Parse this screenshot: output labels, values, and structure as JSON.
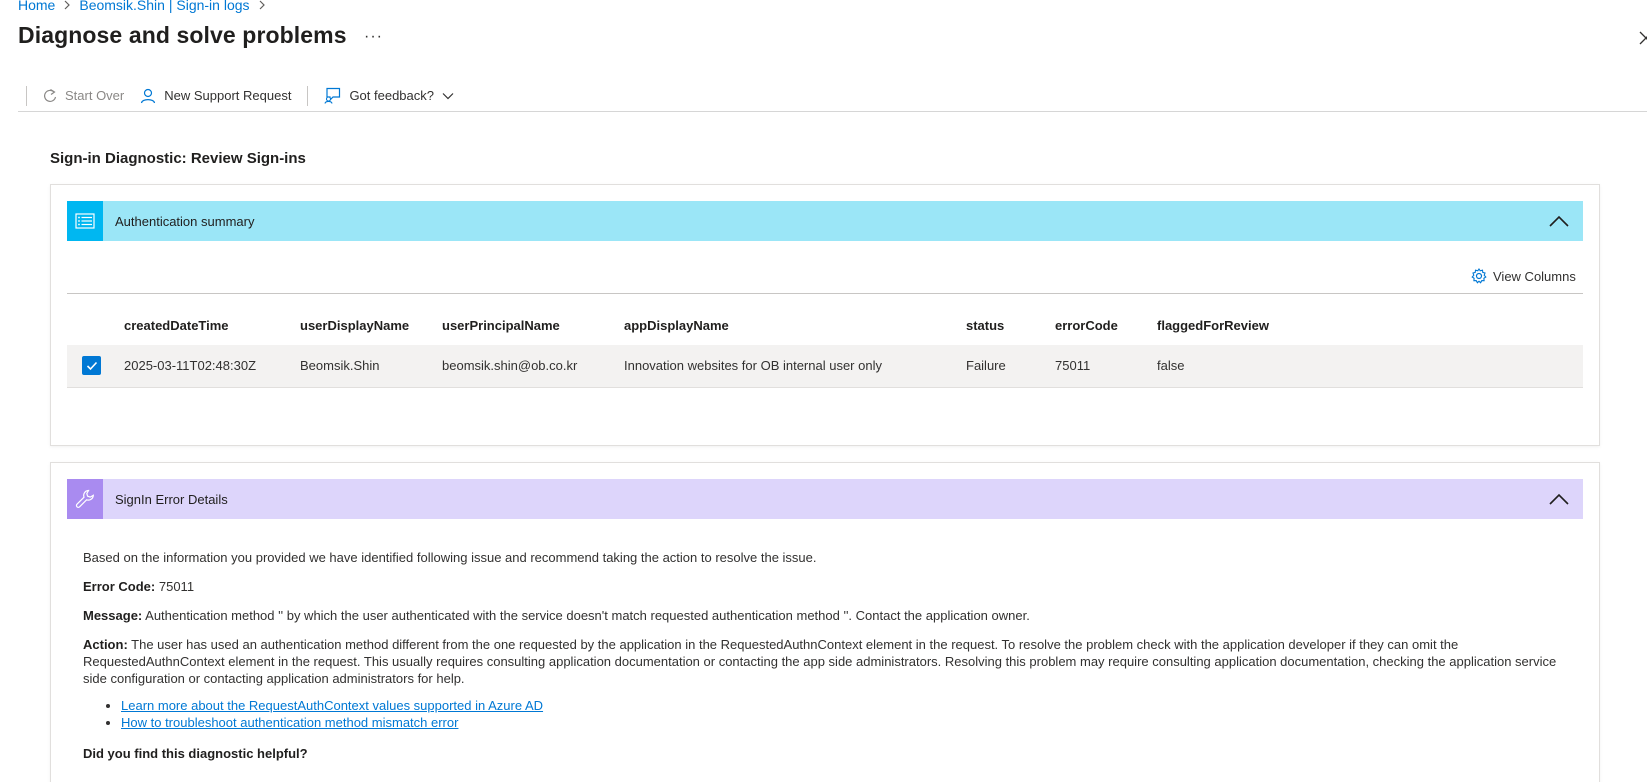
{
  "breadcrumb": {
    "home": "Home",
    "parent": "Beomsik.Shin | Sign-in logs"
  },
  "page": {
    "title": "Diagnose and solve problems",
    "more": "···"
  },
  "toolbar": {
    "start_over": "Start Over",
    "new_support": "New Support Request",
    "feedback": "Got feedback?"
  },
  "section": {
    "heading": "Sign-in Diagnostic: Review Sign-ins"
  },
  "auth_summary": {
    "title": "Authentication summary",
    "view_columns": "View Columns",
    "columns": [
      "createdDateTime",
      "userDisplayName",
      "userPrincipalName",
      "appDisplayName",
      "status",
      "errorCode",
      "flaggedForReview"
    ],
    "rows": [
      {
        "checked": true,
        "cells": [
          "2025-03-11T02:48:30Z",
          "Beomsik.Shin",
          "beomsik.shin@ob.co.kr",
          "Innovation websites for OB internal user only",
          "Failure",
          "75011",
          "false"
        ]
      }
    ]
  },
  "error_details": {
    "title": "SignIn Error Details",
    "intro": "Based on the information you provided we have identified following issue and recommend taking the action to resolve the issue.",
    "error_code_label": "Error Code:",
    "error_code": "75011",
    "message_label": "Message:",
    "message": "Authentication method '' by which the user authenticated with the service doesn't match requested authentication method ''. Contact the application owner.",
    "action_label": "Action:",
    "action": "The user has used an authentication method different from the one requested by the application in the RequestedAuthnContext element in the request. To resolve the problem check with the application developer if they can omit the RequestedAuthnContext element in the request. This usually requires consulting application documentation or contacting the app side administrators. Resolving this problem may require consulting application documentation, checking the application service side configuration or contacting application administrators for help.",
    "links": [
      "Learn more about the RequestAuthContext values supported in Azure AD",
      "How to troubleshoot authentication method mismatch error"
    ],
    "helpful": "Did you find this diagnostic helpful?"
  },
  "colors": {
    "link": "#0078d4",
    "auth_header": "#9be6f7",
    "auth_icon": "#00b7f1",
    "error_header": "#ddd5fb",
    "error_icon": "#a98bf0"
  }
}
